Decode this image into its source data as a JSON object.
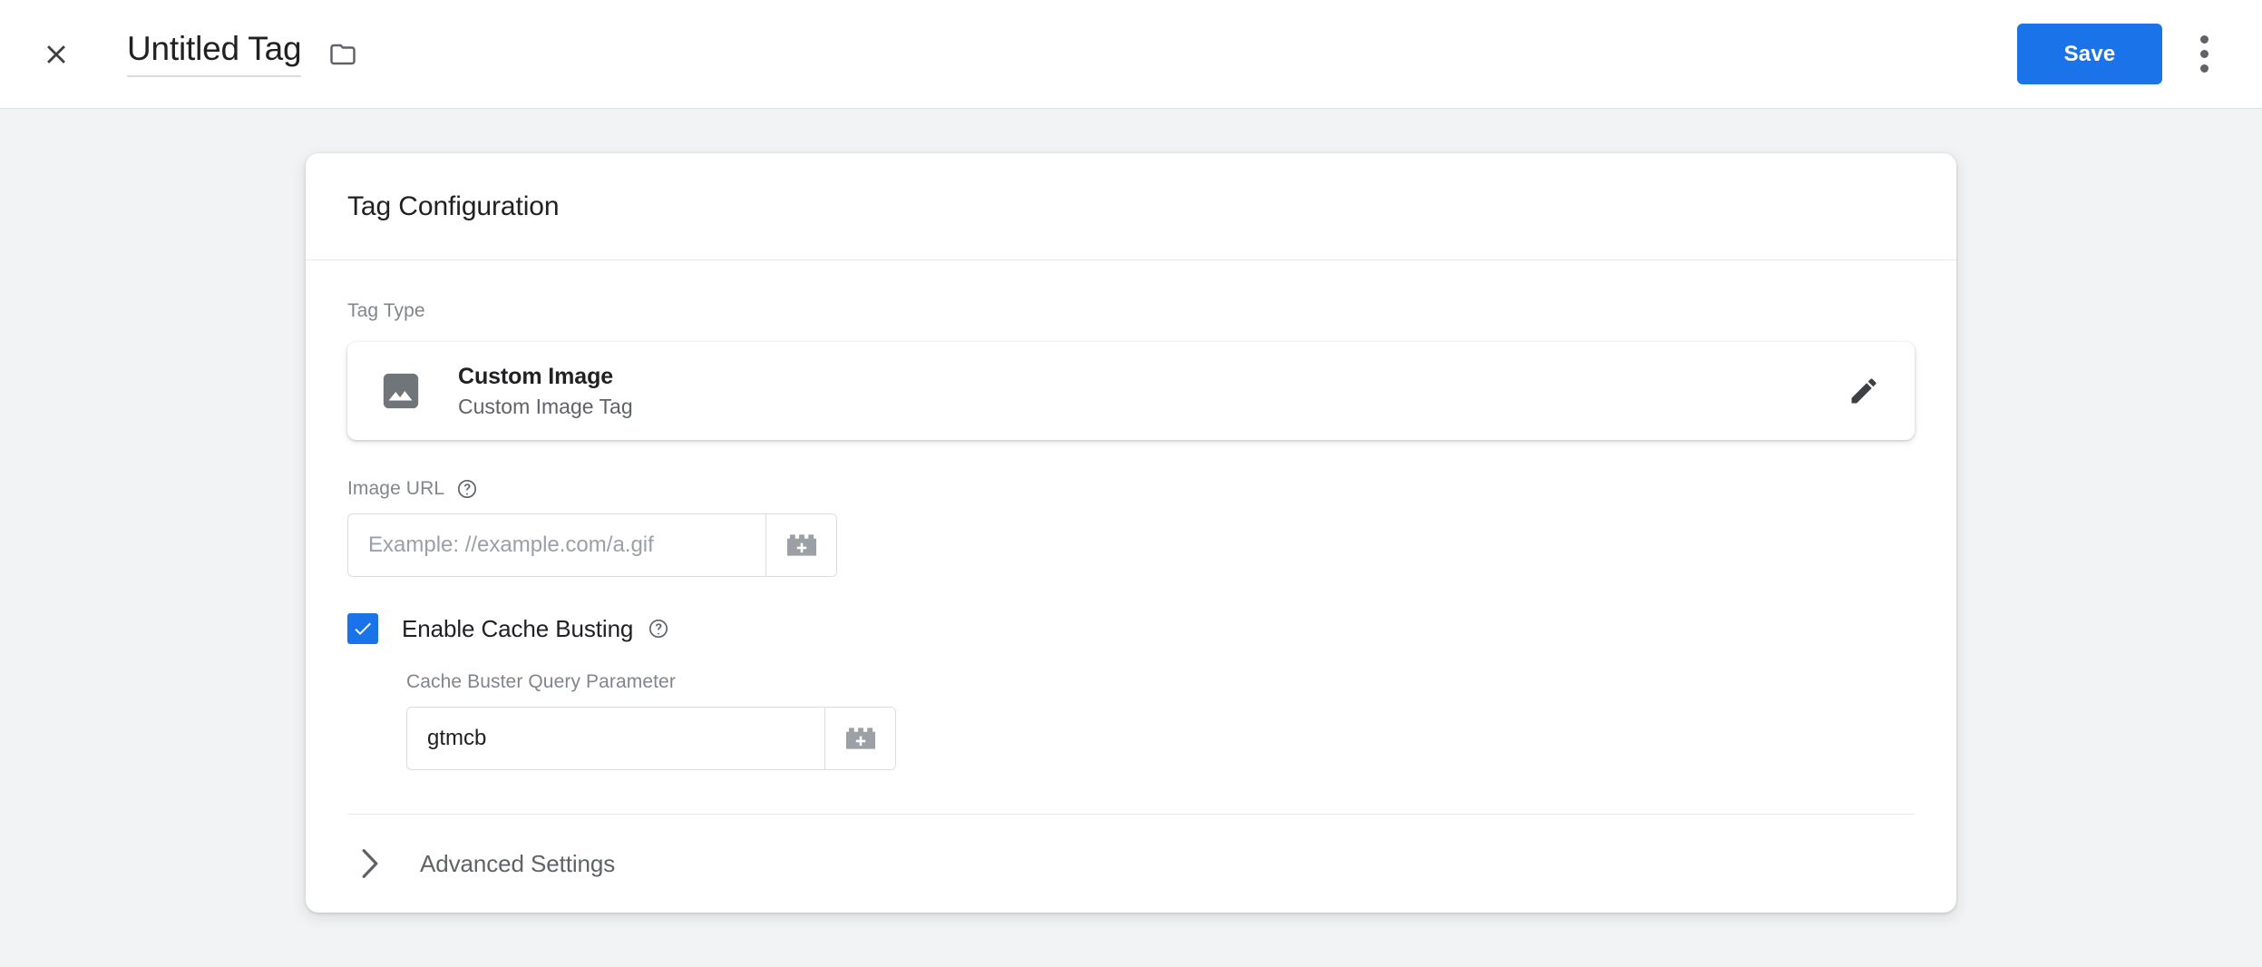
{
  "appbar": {
    "close_icon": "close-icon",
    "title": "Untitled Tag",
    "folder_icon": "folder-icon",
    "save_label": "Save",
    "more_icon": "more-vert-icon"
  },
  "card": {
    "heading": "Tag Configuration",
    "tag_type": {
      "label": "Tag Type",
      "icon": "image-icon",
      "title": "Custom Image",
      "subtitle": "Custom Image Tag",
      "edit_icon": "pencil-icon"
    },
    "image_url": {
      "label": "Image URL",
      "help_icon": "help-circle-icon",
      "value": "",
      "placeholder": "Example: //example.com/a.gif",
      "variable_button_icon": "insert-variable-brick-icon"
    },
    "cache_busting": {
      "label": "Enable Cache Busting",
      "checked": true,
      "check_icon": "checkmark-icon",
      "help_icon": "help-circle-icon",
      "param_label": "Cache Buster Query Parameter",
      "param_value": "gtmcb",
      "param_placeholder": "",
      "variable_button_icon": "insert-variable-brick-icon"
    },
    "advanced": {
      "label": "Advanced Settings",
      "chevron_icon": "chevron-right-icon",
      "expanded": false
    }
  },
  "colors": {
    "accent": "#1a73e8",
    "page_bg": "#f1f3f4",
    "card_bg": "#ffffff",
    "text_primary": "#202124",
    "text_secondary": "#5f6368",
    "text_muted": "#80868b"
  }
}
